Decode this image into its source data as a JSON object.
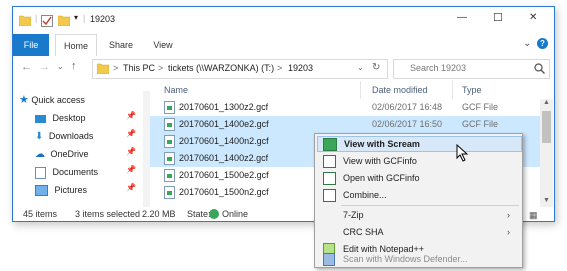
{
  "window": {
    "title": "19203",
    "controls": {
      "minimize": "—",
      "maximize": "☐",
      "close": "✕"
    }
  },
  "ribbon": {
    "tabs": [
      {
        "label": "File"
      },
      {
        "label": "Home"
      },
      {
        "label": "Share"
      },
      {
        "label": "View"
      }
    ],
    "expand_glyph": "⌄",
    "help_glyph": "?"
  },
  "address_bar": {
    "segments": [
      "This PC",
      "tickets (\\\\WARZONKA) (T:)",
      "19203"
    ],
    "separator": ">",
    "search_placeholder": "Search 19203"
  },
  "columns": {
    "name": "Name",
    "date_modified": "Date modified",
    "type": "Type"
  },
  "files": [
    {
      "name": "20170601_1300z2.gcf",
      "date": "02/06/2017 16:48",
      "type": "GCF File",
      "selected": false
    },
    {
      "name": "20170601_1400e2.gcf",
      "date": "02/06/2017 16:50",
      "type": "GCF File",
      "selected": true
    },
    {
      "name": "20170601_1400n2.gcf",
      "date": "",
      "type": "",
      "selected": true
    },
    {
      "name": "20170601_1400z2.gcf",
      "date": "",
      "type": "",
      "selected": true
    },
    {
      "name": "20170601_1500e2.gcf",
      "date": "",
      "type": "",
      "selected": false
    },
    {
      "name": "20170601_1500n2.gcf",
      "date": "",
      "type": "",
      "selected": false
    }
  ],
  "nav": [
    {
      "label": "Quick access",
      "icon": "star-icon",
      "pinned": false
    },
    {
      "label": "Desktop",
      "icon": "desktop-icon",
      "pinned": true
    },
    {
      "label": "Downloads",
      "icon": "download-icon",
      "pinned": true
    },
    {
      "label": "OneDrive",
      "icon": "cloud-icon",
      "pinned": true
    },
    {
      "label": "Documents",
      "icon": "documents-icon",
      "pinned": true
    },
    {
      "label": "Pictures",
      "icon": "pictures-icon",
      "pinned": true
    }
  ],
  "status_bar": {
    "items_count": "45 items",
    "selected": "3 items selected",
    "size": "2.20 MB",
    "state_label": "State:",
    "state_value": "Online"
  },
  "context_menu": {
    "items": [
      {
        "label": "View with Scream",
        "bold": true,
        "hot": true,
        "icon": "scream-icon",
        "submenu": false
      },
      {
        "label": "View with GCFinfo",
        "icon": "gcfinfo-icon",
        "submenu": false
      },
      {
        "label": "Open with GCFinfo",
        "icon": "gcfinfo-icon",
        "submenu": false
      },
      {
        "label": "Combine...",
        "icon": "gcfinfo-icon",
        "submenu": false
      },
      {
        "label": "7-Zip",
        "icon": "",
        "submenu": true
      },
      {
        "label": "CRC SHA",
        "icon": "",
        "submenu": true
      },
      {
        "label": "Edit with Notepad++",
        "icon": "notepad-icon",
        "submenu": false
      },
      {
        "label": "Scan with Windows Defender...",
        "icon": "defender-icon",
        "submenu": false,
        "disabled": true
      }
    ]
  },
  "colors": {
    "accent": "#1979ca",
    "selection": "#cce8ff",
    "folder": "#f2c94c",
    "border": "#2b79d6"
  }
}
